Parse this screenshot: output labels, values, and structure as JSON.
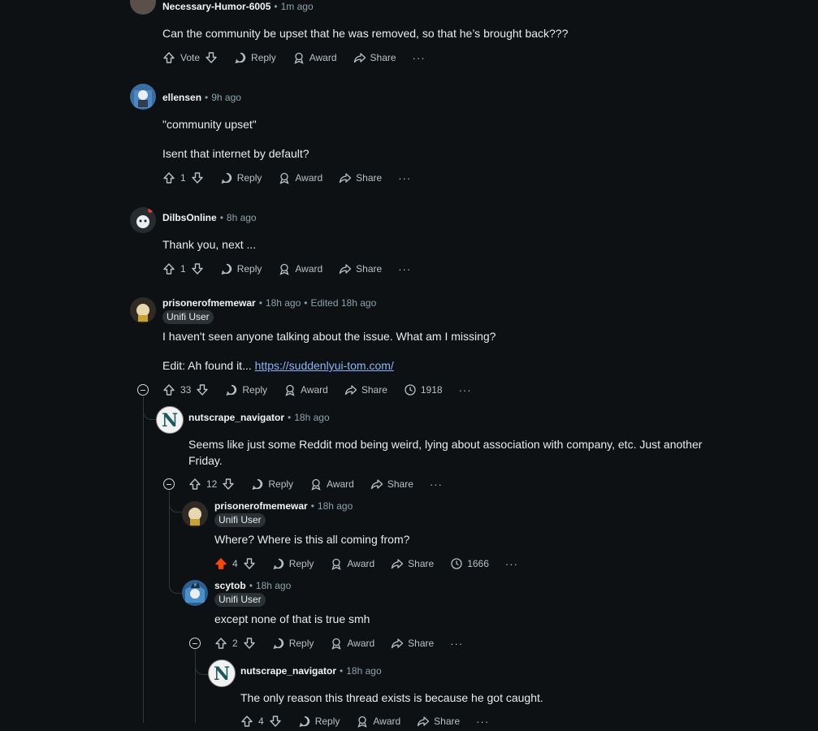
{
  "comments": [
    {
      "author": "Necessary-Humor-6005",
      "time": "1m ago",
      "body": [
        "Can the community be upset that he was removed, so that he’s brought back???"
      ],
      "score": "Vote",
      "reply_label": "Reply",
      "award_label": "Award",
      "share_label": "Share",
      "more": "···"
    },
    {
      "author": "ellensen",
      "time": "9h ago",
      "body": [
        "\"community upset\"",
        "Isent that internet by default?"
      ],
      "score": "1",
      "reply_label": "Reply",
      "award_label": "Award",
      "share_label": "Share",
      "more": "···"
    },
    {
      "author": "DilbsOnline",
      "time": "8h ago",
      "body": [
        "Thank you, next ..."
      ],
      "score": "1",
      "reply_label": "Reply",
      "award_label": "Award",
      "share_label": "Share",
      "more": "···"
    },
    {
      "author": "prisonerofmemewar",
      "time": "18h ago",
      "edited": "Edited 18h ago",
      "flair": "Unifi User",
      "body": [
        "I haven't seen anyone talking about the issue. What am I missing?"
      ],
      "edit_prefix": "Edit: Ah found it... ",
      "link": "https://suddenlyui-tom.com/",
      "score": "33",
      "reply_label": "Reply",
      "award_label": "Award",
      "share_label": "Share",
      "extra_count": "1918",
      "more": "···"
    },
    {
      "author": "nutscrape_navigator",
      "time": "18h ago",
      "body": [
        "Seems like just some Reddit mod being weird, lying about association with company, etc. Just another",
        "Friday."
      ],
      "score": "12",
      "reply_label": "Reply",
      "award_label": "Award",
      "share_label": "Share",
      "more": "···"
    },
    {
      "author": "prisonerofmemewar",
      "time": "18h ago",
      "flair": "Unifi User",
      "body": [
        "Where? Where is this all coming from?"
      ],
      "score": "4",
      "reply_label": "Reply",
      "award_label": "Award",
      "share_label": "Share",
      "extra_count": "1666",
      "more": "···"
    },
    {
      "author": "scytob",
      "time": "18h ago",
      "flair": "Unifi User",
      "body": [
        "except none of that is true smh"
      ],
      "score": "2",
      "reply_label": "Reply",
      "award_label": "Award",
      "share_label": "Share",
      "more": "···"
    },
    {
      "author": "nutscrape_navigator",
      "time": "18h ago",
      "body": [
        "The only reason this thread exists is because he got caught."
      ],
      "score": "4",
      "reply_label": "Reply",
      "award_label": "Award",
      "share_label": "Share",
      "more": "···"
    }
  ],
  "colors": {
    "upvoted": "#ff4500",
    "link": "#8ab4f8",
    "background": "#0e1113"
  },
  "icons": [
    "upvote-icon",
    "downvote-icon",
    "reply-icon",
    "award-icon",
    "share-icon",
    "clock-icon",
    "more-icon",
    "collapse-icon"
  ]
}
